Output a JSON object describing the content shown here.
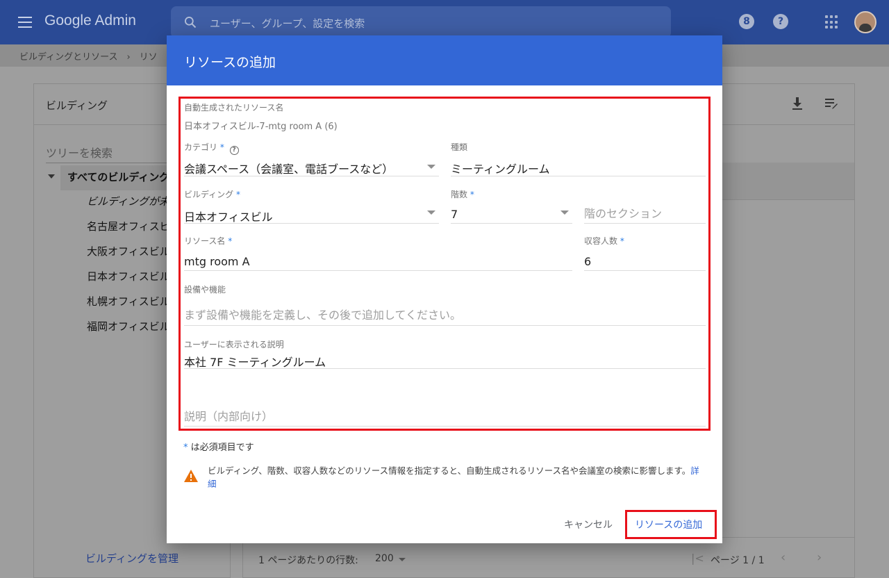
{
  "topbar": {
    "brand": "Google Admin",
    "search_placeholder": "ユーザー、グループ、設定を検索",
    "support_icon_glyph": "8",
    "help_icon_glyph": "?"
  },
  "breadcrumb": "ビルディングとリソース　›　リソ",
  "left_panel": {
    "title": "ビルディング",
    "tree_search_placeholder": "ツリーを検索",
    "tree_root": "すべてのビルディング",
    "tree_items": [
      "ビルディングが未",
      "名古屋オフィスビ",
      "大阪オフィスビル",
      "日本オフィスビル",
      "札幌オフィスビル",
      "福岡オフィスビル"
    ],
    "manage_link": "ビルディングを管理"
  },
  "right_panel": {
    "rows_per_page_label": "1 ページあたりの行数:",
    "rows_per_page_value": "200",
    "page_label": "ページ 1 / 1"
  },
  "dialog": {
    "title": "リソースの追加",
    "auto_name_label": "自動生成されたリソース名",
    "auto_name_value": "日本オフィスビル-7-mtg room A (6)",
    "category": {
      "label": "カテゴリ",
      "required_mark": "*",
      "value": "会議スペース（会議室、電話ブースなど）"
    },
    "type": {
      "label": "種類",
      "value": "ミーティングルーム"
    },
    "building": {
      "label": "ビルディング",
      "required_mark": "*",
      "value": "日本オフィスビル"
    },
    "floor": {
      "label": "階数",
      "required_mark": "*",
      "value": "7"
    },
    "floor_section": {
      "placeholder": "階のセクション"
    },
    "resource_name": {
      "label": "リソース名",
      "required_mark": "*",
      "value": "mtg room A"
    },
    "capacity": {
      "label": "収容人数",
      "required_mark": "*",
      "value": "6"
    },
    "features": {
      "label": "設備や機能",
      "placeholder": "まず設備や機能を定義し、その後で追加してください。"
    },
    "user_description": {
      "label": "ユーザーに表示される説明",
      "value": "本社 7F ミーティングルーム"
    },
    "internal_description": {
      "placeholder": "説明（内部向け）"
    },
    "required_note_mark": "*",
    "required_note": " は必須項目です",
    "warning_text": "ビルディング、階数、収容人数などのリソース情報を指定すると、自動生成されるリソース名や会議室の検索に影響します。",
    "warning_link": "詳細",
    "cancel_label": "キャンセル",
    "add_label": "リソースの追加"
  },
  "colors": {
    "header_blue": "#3367d6",
    "highlight_red": "#e8101a",
    "warning_orange": "#e8710a",
    "required_blue": "#2a7be4"
  }
}
